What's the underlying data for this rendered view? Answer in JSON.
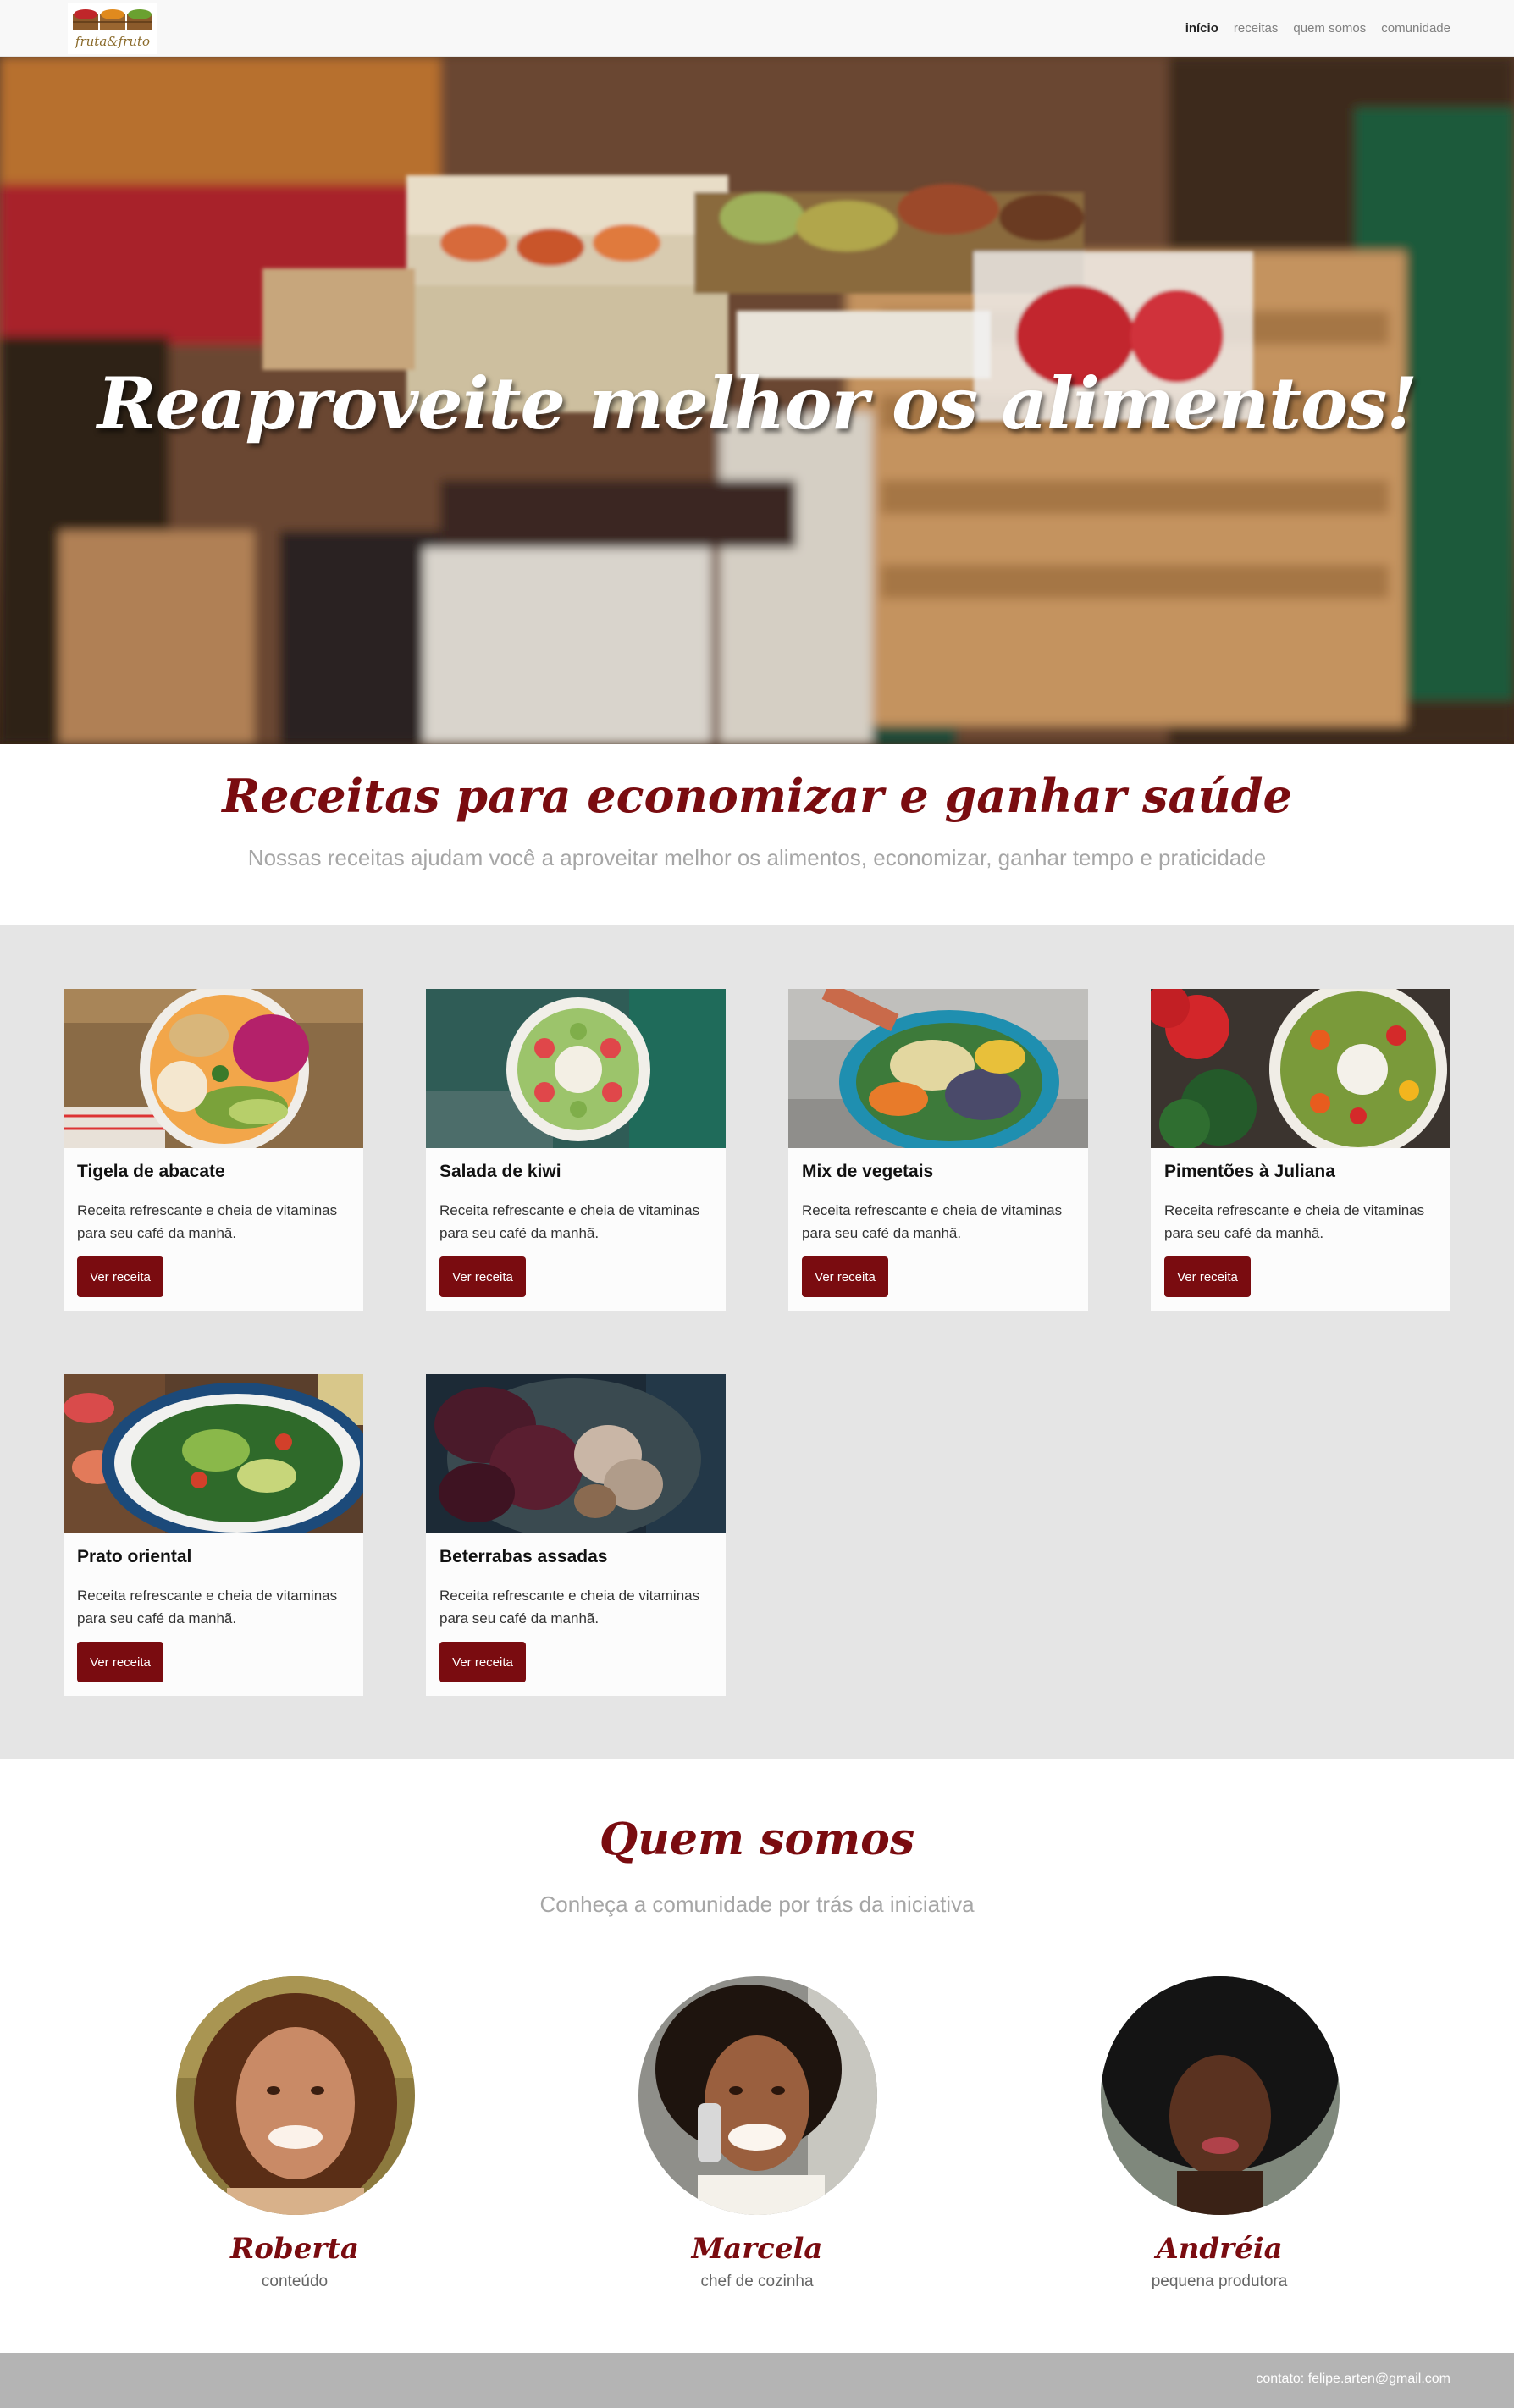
{
  "brand": {
    "logo_text": "fruta&fruto"
  },
  "nav": {
    "items": [
      {
        "label": "início",
        "active": true
      },
      {
        "label": "receitas",
        "active": false
      },
      {
        "label": "quem somos",
        "active": false
      },
      {
        "label": "comunidade",
        "active": false
      }
    ]
  },
  "hero": {
    "title": "Reaproveite melhor os alimentos!"
  },
  "recipes_section": {
    "title": "Receitas para economizar e ganhar saúde",
    "subtitle": "Nossas receitas ajudam você a aproveitar melhor os alimentos, economizar, ganhar tempo e praticidade",
    "cards": [
      {
        "title": "Tigela de abacate",
        "description": "Receita refrescante e cheia de vitaminas para seu café da manhã.",
        "button": "Ver receita"
      },
      {
        "title": "Salada de kiwi",
        "description": "Receita refrescante e cheia de vitaminas para seu café da manhã.",
        "button": "Ver receita"
      },
      {
        "title": "Mix de vegetais",
        "description": "Receita refrescante e cheia de vitaminas para seu café da manhã.",
        "button": "Ver receita"
      },
      {
        "title": "Pimentões à Juliana",
        "description": "Receita refrescante e cheia de vitaminas para seu café da manhã.",
        "button": "Ver receita"
      },
      {
        "title": "Prato oriental",
        "description": "Receita refrescante e cheia de vitaminas para seu café da manhã.",
        "button": "Ver receita"
      },
      {
        "title": "Beterrabas assadas",
        "description": "Receita refrescante e cheia de vitaminas para seu café da manhã.",
        "button": "Ver receita"
      }
    ]
  },
  "about_section": {
    "title": "Quem somos",
    "subtitle": "Conheça a comunidade por trás da iniciativa",
    "members": [
      {
        "name": "Roberta",
        "role": "conteúdo"
      },
      {
        "name": "Marcela",
        "role": "chef de cozinha"
      },
      {
        "name": "Andréia",
        "role": "pequena produtora"
      }
    ]
  },
  "footer": {
    "contact": "contato: felipe.arten@gmail.com"
  },
  "colors": {
    "accent": "#7a0c10",
    "recipes_bg": "#e5e5e5",
    "footer_bg": "#b4b4b4",
    "navbar_bg": "#f8f8f8"
  }
}
